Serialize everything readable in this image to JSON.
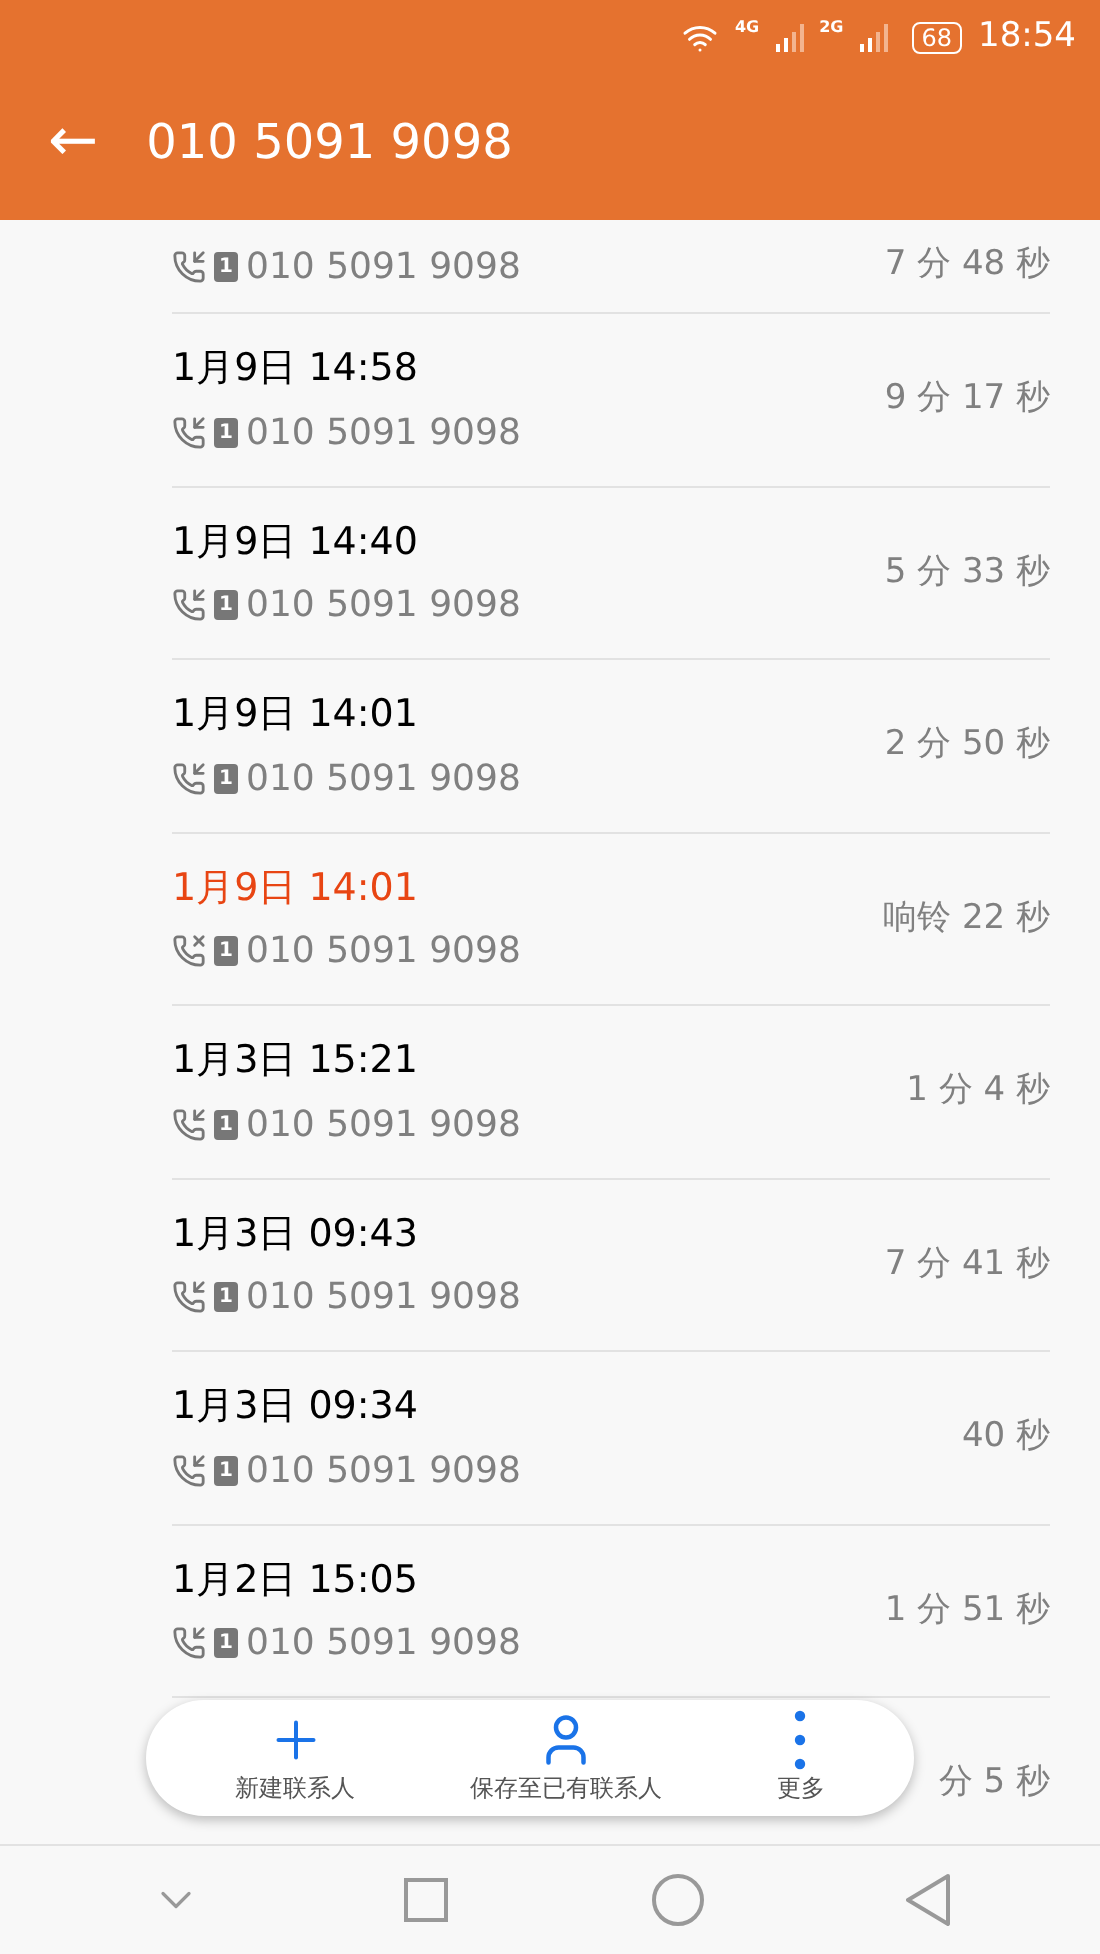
{
  "status_bar": {
    "network_1": "4G",
    "network_2": "2G",
    "battery": "68",
    "time": "18:54"
  },
  "header": {
    "back": "←",
    "title": "010 5091 9098"
  },
  "calls": [
    {
      "kind": "incoming",
      "sim": "1",
      "number": "010 5091 9098",
      "duration": "7 分 48 秒"
    },
    {
      "kind": "incoming",
      "date": "1月9日 14:58",
      "sim": "1",
      "number": "010 5091 9098",
      "duration": "9 分 17 秒"
    },
    {
      "kind": "incoming",
      "date": "1月9日 14:40",
      "sim": "1",
      "number": "010 5091 9098",
      "duration": "5 分 33 秒"
    },
    {
      "kind": "incoming",
      "date": "1月9日 14:01",
      "sim": "1",
      "number": "010 5091 9098",
      "duration": "2 分 50 秒"
    },
    {
      "kind": "missed",
      "date": "1月9日 14:01",
      "sim": "1",
      "number": "010 5091 9098",
      "duration": "响铃 22 秒"
    },
    {
      "kind": "incoming",
      "date": "1月3日 15:21",
      "sim": "1",
      "number": "010 5091 9098",
      "duration": "1 分 4 秒"
    },
    {
      "kind": "incoming",
      "date": "1月3日 09:43",
      "sim": "1",
      "number": "010 5091 9098",
      "duration": "7 分 41 秒"
    },
    {
      "kind": "incoming",
      "date": "1月3日 09:34",
      "sim": "1",
      "number": "010 5091 9098",
      "duration": "40 秒"
    },
    {
      "kind": "incoming",
      "date": "1月2日 15:05",
      "sim": "1",
      "number": "010 5091 9098",
      "duration": "1 分 51 秒"
    },
    {
      "duration": "分 5 秒"
    }
  ],
  "actions": [
    {
      "kind": "add",
      "label": "新建联系人"
    },
    {
      "kind": "person",
      "label": "保存至已有联系人"
    },
    {
      "kind": "more",
      "label": "更多"
    }
  ]
}
